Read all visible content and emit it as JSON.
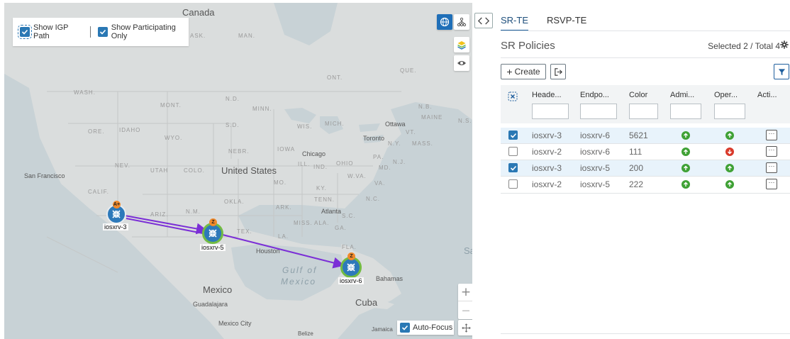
{
  "map": {
    "options": {
      "show_igp_path_label": "Show IGP Path",
      "show_igp_path_checked": true,
      "show_participating_label": "Show Participating Only",
      "show_participating_checked": true
    },
    "labels": {
      "canada": "Canada",
      "ask": "ASK.",
      "man": "MAN.",
      "ont": "ONT.",
      "que": "QUE.",
      "wash": "WASH.",
      "mont": "MONT.",
      "nd": "N.D.",
      "minn": "MINN.",
      "nb": "N.B.",
      "maine": "MAINE",
      "ns": "N.S.",
      "ore": "ORE.",
      "idaho": "IDAHO",
      "sd": "S.D.",
      "wis": "WIS.",
      "mich": "MICH.",
      "ottawa": "Ottawa",
      "vt": "VT.",
      "wyo": "WYO.",
      "toronto": "Toronto",
      "ny": "N.Y.",
      "mass": "MASS.",
      "nebr": "NEBR.",
      "iowa": "IOWA",
      "chicago": "Chicago",
      "pa": "PA.",
      "nev": "NEV.",
      "utah": "UTAH",
      "colo": "COLO.",
      "united_states": "United States",
      "ill": "ILL.",
      "ind": "IND.",
      "ohio": "OHIO",
      "md": "MD.",
      "nj": "N.J.",
      "san_francisco": "San Francisco",
      "calif": "CALIF.",
      "mo": "MO.",
      "wva": "W.VA.",
      "va": "VA.",
      "ky": "KY.",
      "okla": "OKLA.",
      "tenn": "TENN.",
      "ark": "ARK.",
      "nc": "N.C.",
      "ariz": "ARIZ.",
      "nm": "N.M.",
      "atlanta": "Atlanta",
      "sc": "S.C.",
      "miss": "MISS.",
      "ala": "ALA.",
      "ga": "GA.",
      "tex": "TEX.",
      "la": "LA.",
      "houston": "Houston",
      "fla": "FLA.",
      "gulf_of": "Gulf of",
      "mexico_sea": "Mexico",
      "sar": "Sar",
      "mexico": "Mexico",
      "guadalajara": "Guadalajara",
      "mexico_city": "Mexico City",
      "bahamas": "Bahamas",
      "cuba": "Cuba",
      "jamaica": "Jamaica",
      "belize": "Belize"
    },
    "nodes": [
      {
        "name": "iosxrv-3",
        "badge": "A+"
      },
      {
        "name": "iosxrv-5",
        "badge": "Z"
      },
      {
        "name": "iosxrv-6",
        "badge": "Z"
      }
    ],
    "auto_focus_label": "Auto-Focus",
    "auto_focus_checked": true,
    "zoom_in": "+",
    "zoom_out": "—",
    "icons": [
      "globe-icon",
      "topology-icon",
      "layers-icon",
      "eye-icon",
      "move-icon"
    ]
  },
  "panel": {
    "tabs": [
      {
        "label": "SR-TE",
        "active": true
      },
      {
        "label": "RSVP-TE",
        "active": false
      }
    ],
    "title": "SR Policies",
    "selection_summary": "Selected 2 / Total 4",
    "create_label": "Create",
    "columns": [
      "Heade...",
      "Endpo...",
      "Color",
      "Admi...",
      "Oper...",
      "Acti..."
    ],
    "rows": [
      {
        "headend": "iosxrv-3",
        "endpoint": "iosxrv-6",
        "color": "5621",
        "admin": "up",
        "oper": "up",
        "selected": true
      },
      {
        "headend": "iosxrv-2",
        "endpoint": "iosxrv-6",
        "color": "111",
        "admin": "up",
        "oper": "down",
        "selected": false
      },
      {
        "headend": "iosxrv-3",
        "endpoint": "iosxrv-5",
        "color": "200",
        "admin": "up",
        "oper": "up",
        "selected": true
      },
      {
        "headend": "iosxrv-2",
        "endpoint": "iosxrv-5",
        "color": "222",
        "admin": "up",
        "oper": "up",
        "selected": false
      }
    ],
    "status_colors": {
      "up": "#3fa135",
      "down": "#d93a2b"
    },
    "accent": "#1f5f9e"
  }
}
